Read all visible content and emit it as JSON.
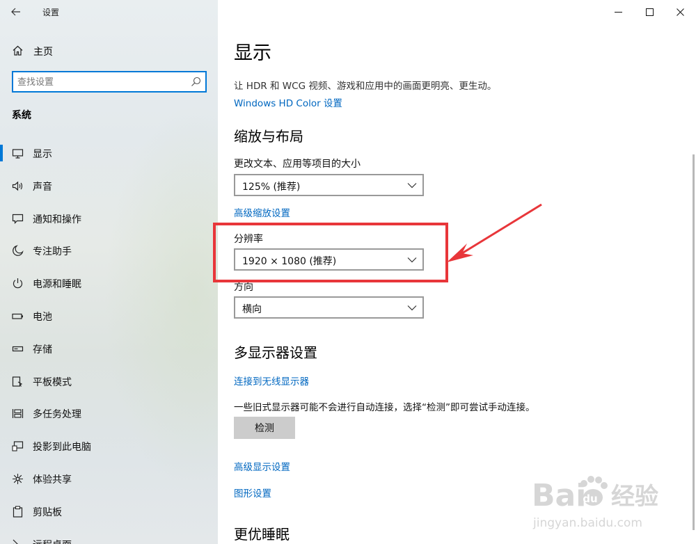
{
  "window": {
    "title": "设置",
    "controls": {
      "minimize": "—",
      "maximize": "☐",
      "close": "✕"
    }
  },
  "sidebar": {
    "home_label": "主页",
    "search_placeholder": "查找设置",
    "section_label": "系统",
    "items": [
      {
        "label": "显示",
        "icon": "monitor-icon",
        "active": true
      },
      {
        "label": "声音",
        "icon": "speaker-icon"
      },
      {
        "label": "通知和操作",
        "icon": "message-icon"
      },
      {
        "label": "专注助手",
        "icon": "moon-icon"
      },
      {
        "label": "电源和睡眠",
        "icon": "power-icon"
      },
      {
        "label": "电池",
        "icon": "battery-icon"
      },
      {
        "label": "存储",
        "icon": "storage-icon"
      },
      {
        "label": "平板模式",
        "icon": "tablet-icon"
      },
      {
        "label": "多任务处理",
        "icon": "multitask-icon"
      },
      {
        "label": "投影到此电脑",
        "icon": "project-icon"
      },
      {
        "label": "体验共享",
        "icon": "share-icon"
      },
      {
        "label": "剪贴板",
        "icon": "clipboard-icon"
      },
      {
        "label": "远程桌面",
        "icon": "remote-icon"
      }
    ]
  },
  "main": {
    "title": "显示",
    "hdr_desc": "让 HDR 和 WCG 视频、游戏和应用中的画面更明亮、更生动。",
    "hdr_link": "Windows HD Color 设置",
    "scale_section": "缩放与布局",
    "scale_label": "更改文本、应用等项目的大小",
    "scale_value": "125% (推荐)",
    "advanced_scaling_link": "高级缩放设置",
    "resolution_label": "分辨率",
    "resolution_value": "1920 × 1080 (推荐)",
    "orientation_label": "方向",
    "orientation_value": "横向",
    "multi_section": "多显示器设置",
    "wireless_link": "连接到无线显示器",
    "detect_desc": "一些旧式显示器可能不会进行自动连接，选择“检测”即可尝试手动连接。",
    "detect_button": "检测",
    "advanced_display_link": "高级显示设置",
    "graphics_link": "图形设置",
    "sleep_section": "更优睡眠"
  },
  "watermark": {
    "brand": "Bai",
    "brand_cn": "经验",
    "url": "jingyan.baidu.com"
  },
  "colors": {
    "accent": "#0078d7",
    "link": "#0067c0",
    "annotation": "#e8363a"
  }
}
